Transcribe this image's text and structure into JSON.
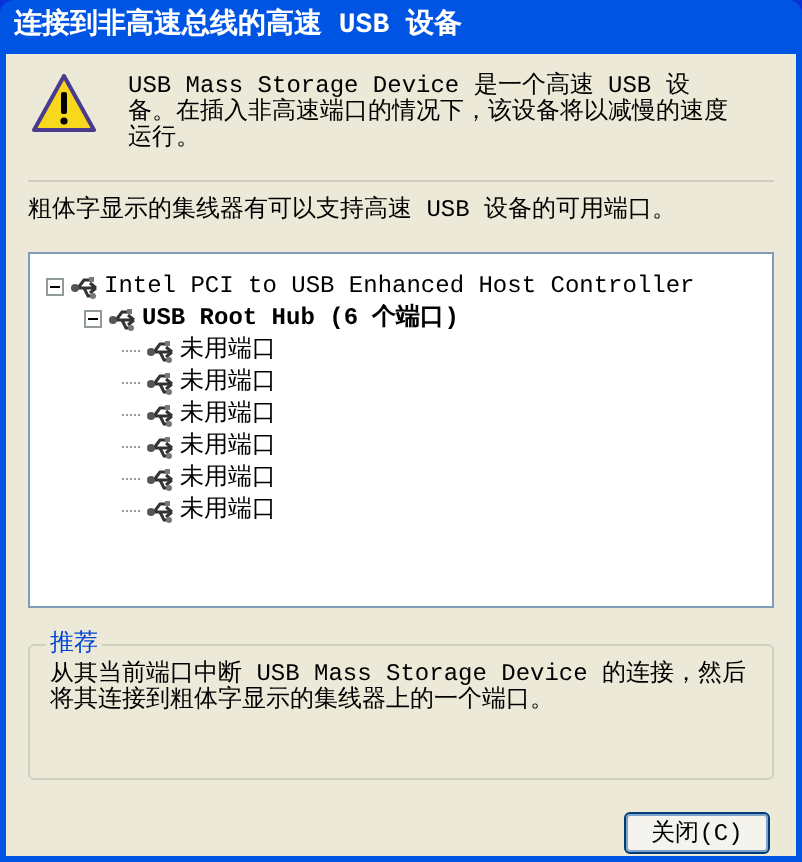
{
  "window": {
    "title": "连接到非高速总线的高速 USB 设备"
  },
  "message": "USB Mass Storage Device 是一个高速 USB 设备。在插入非高速端口的情况下，该设备将以减慢的速度运行。",
  "hint": "粗体字显示的集线器有可以支持高速 USB 设备的可用端口。",
  "tree": [
    {
      "label": "Intel PCI to USB Enhanced Host Controller",
      "high_speed": false,
      "expanded": true,
      "children": [
        {
          "label": "USB Root Hub (6 个端口)",
          "high_speed": true,
          "expanded": true,
          "children": [
            {
              "label": "未用端口",
              "high_speed": false
            },
            {
              "label": "未用端口",
              "high_speed": false
            },
            {
              "label": "未用端口",
              "high_speed": false
            },
            {
              "label": "未用端口",
              "high_speed": false
            },
            {
              "label": "未用端口",
              "high_speed": false
            },
            {
              "label": "未用端口",
              "high_speed": false
            }
          ]
        }
      ]
    }
  ],
  "recommendation": {
    "title": "推荐",
    "text": "从其当前端口中断 USB Mass Storage Device 的连接，然后将其连接到粗体字显示的集线器上的一个端口。"
  },
  "buttons": [
    {
      "label": "关闭(C)"
    }
  ]
}
